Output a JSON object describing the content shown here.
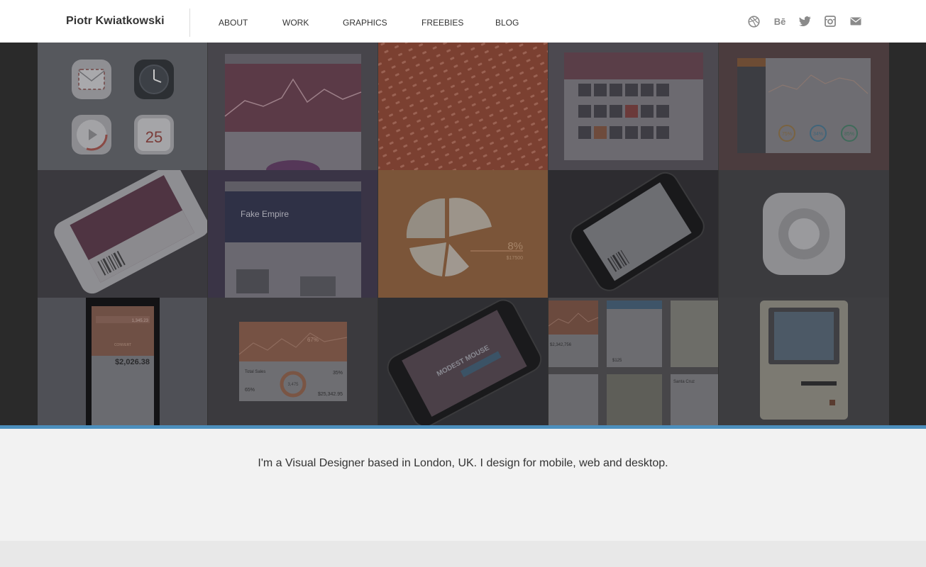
{
  "brand": {
    "name": "Piotr Kwiatkowski"
  },
  "nav": {
    "items": [
      {
        "label": "ABOUT"
      },
      {
        "label": "WORK"
      },
      {
        "label": "GRAPHICS"
      },
      {
        "label": "FREEBIES"
      },
      {
        "label": "BLOG"
      }
    ]
  },
  "social": [
    {
      "icon": "dribbble-icon"
    },
    {
      "icon": "behance-icon",
      "label": "Bē"
    },
    {
      "icon": "twitter-icon"
    },
    {
      "icon": "instagram-icon"
    },
    {
      "icon": "mail-icon"
    }
  ],
  "portfolio": {
    "tiles": [
      {
        "name": "ios-icons",
        "calendar_day": "25"
      },
      {
        "name": "analytics-dashboard"
      },
      {
        "name": "icon-pattern"
      },
      {
        "name": "photo-gallery-app"
      },
      {
        "name": "admin-dashboard",
        "stats": [
          "75%",
          "34%",
          "85%"
        ]
      },
      {
        "name": "ticket-app"
      },
      {
        "name": "music-site",
        "headline": "Fake Empire"
      },
      {
        "name": "pie-chart",
        "percent": "8%",
        "amount": "$17500"
      },
      {
        "name": "valentine-ticket"
      },
      {
        "name": "knob-icon"
      },
      {
        "name": "currency-converter",
        "amount": "$2,026.38",
        "input": "1,345.23",
        "button": "CONVERT"
      },
      {
        "name": "sales-widget",
        "total": "Total Sales",
        "percent": "67%",
        "center": "3,475",
        "left_percent": "65%",
        "right_percent": "35%",
        "sum": "$25,342.95"
      },
      {
        "name": "concert-ticket",
        "title": "MODEST MOUSE",
        "dates": [
          "14",
          "15",
          "16",
          "17"
        ]
      },
      {
        "name": "ui-kit",
        "amount": "$2,342,756",
        "price": "$125",
        "place": "Santa Cruz"
      },
      {
        "name": "macintosh-ipad"
      }
    ]
  },
  "intro": {
    "text": "I'm a Visual Designer based in London, UK. I design for mobile, web and desktop."
  },
  "colors": {
    "accent": "#4c8fbd",
    "hero_bg": "#2a2a2a",
    "intro_bg": "#f2f2f2"
  }
}
